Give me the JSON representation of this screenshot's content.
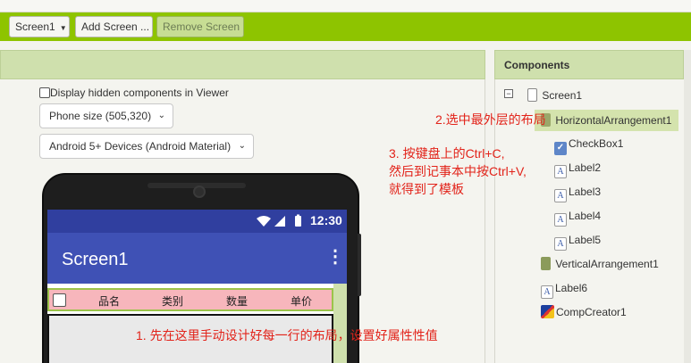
{
  "toolbar": {
    "screen_select": "Screen1",
    "add_screen": "Add Screen ...",
    "remove_screen": "Remove Screen"
  },
  "viewer": {
    "display_hidden_label": "Display hidden components in Viewer",
    "phone_size": "Phone size (505,320)",
    "theme": "Android 5+ Devices (Android Material)"
  },
  "phone": {
    "status_time": "12:30",
    "app_title": "Screen1",
    "row_labels": [
      "品名",
      "类别",
      "数量",
      "单价"
    ]
  },
  "components": {
    "title": "Components",
    "tree": [
      {
        "label": "Screen1",
        "icon": "screen-icon"
      },
      {
        "label": "HorizontalArrangement1",
        "icon": "horizontal-arrangement-icon"
      },
      {
        "label": "CheckBox1",
        "icon": "checkbox-icon"
      },
      {
        "label": "Label2",
        "icon": "label-icon"
      },
      {
        "label": "Label3",
        "icon": "label-icon"
      },
      {
        "label": "Label4",
        "icon": "label-icon"
      },
      {
        "label": "Label5",
        "icon": "label-icon"
      },
      {
        "label": "VerticalArrangement1",
        "icon": "vertical-arrangement-icon"
      },
      {
        "label": "Label6",
        "icon": "label-icon"
      },
      {
        "label": "CompCreator1",
        "icon": "compcreator-icon"
      }
    ]
  },
  "annotations": {
    "step1": "1. 先在这里手动设计好每一行的布局，设置好属性性值",
    "step2": "2.选中最外层的布局",
    "step3_line1": "3. 按键盘上的Ctrl+C,",
    "step3_line2": "然后到记事本中按Ctrl+V,",
    "step3_line3": "就得到了模板"
  },
  "colors": {
    "toolbar": "#8ec400",
    "panel_header": "#cfe0ad",
    "app_bar": "#3f51b5",
    "status_bar": "#303f9f",
    "annotation": "#e2231a"
  }
}
